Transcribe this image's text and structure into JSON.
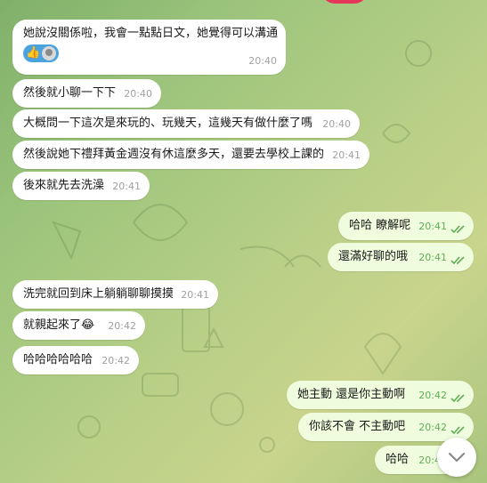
{
  "colors": {
    "incoming_bubble": "#ffffff",
    "outgoing_bubble": "#effdde",
    "outgoing_time": "#5fae56",
    "reaction_pill": "#4aa3df"
  },
  "messages": [
    {
      "text": "她說沒關係啦，我會一點點日文，她覺得可以溝通",
      "time": "20:40",
      "direction": "incoming",
      "reactions": [
        "thumbs-up-emoji",
        "avatar"
      ]
    },
    {
      "text": "然後就小聊一下下",
      "time": "20:40",
      "direction": "incoming"
    },
    {
      "text": "大概問一下這次是來玩的、玩幾天，這幾天有做什麼了嗎",
      "time": "20:40",
      "direction": "incoming"
    },
    {
      "text": "然後說她下禮拜黃金週沒有休這麼多天，還要去學校上課的",
      "time": "20:41",
      "direction": "incoming"
    },
    {
      "text": "後來就先去洗澡",
      "time": "20:41",
      "direction": "incoming"
    },
    {
      "text": "哈哈 瞭解呢",
      "time": "20:41",
      "direction": "outgoing"
    },
    {
      "text": "還滿好聊的哦",
      "time": "20:41",
      "direction": "outgoing"
    },
    {
      "text": "洗完就回到床上躺躺聊聊摸摸",
      "time": "20:41",
      "direction": "incoming"
    },
    {
      "text": "就親起來了😂",
      "time": "20:42",
      "direction": "incoming"
    },
    {
      "text": "哈哈哈哈哈哈",
      "time": "20:42",
      "direction": "incoming"
    },
    {
      "text": "她主動  還是你主動啊",
      "time": "20:42",
      "direction": "outgoing"
    },
    {
      "text": "你該不會  不主動吧",
      "time": "20:42",
      "direction": "outgoing"
    },
    {
      "text": "哈哈",
      "time": "20:42",
      "direction": "outgoing"
    }
  ],
  "reaction_emoji": "👍",
  "scroll_button_icon": "chevron-down-icon"
}
